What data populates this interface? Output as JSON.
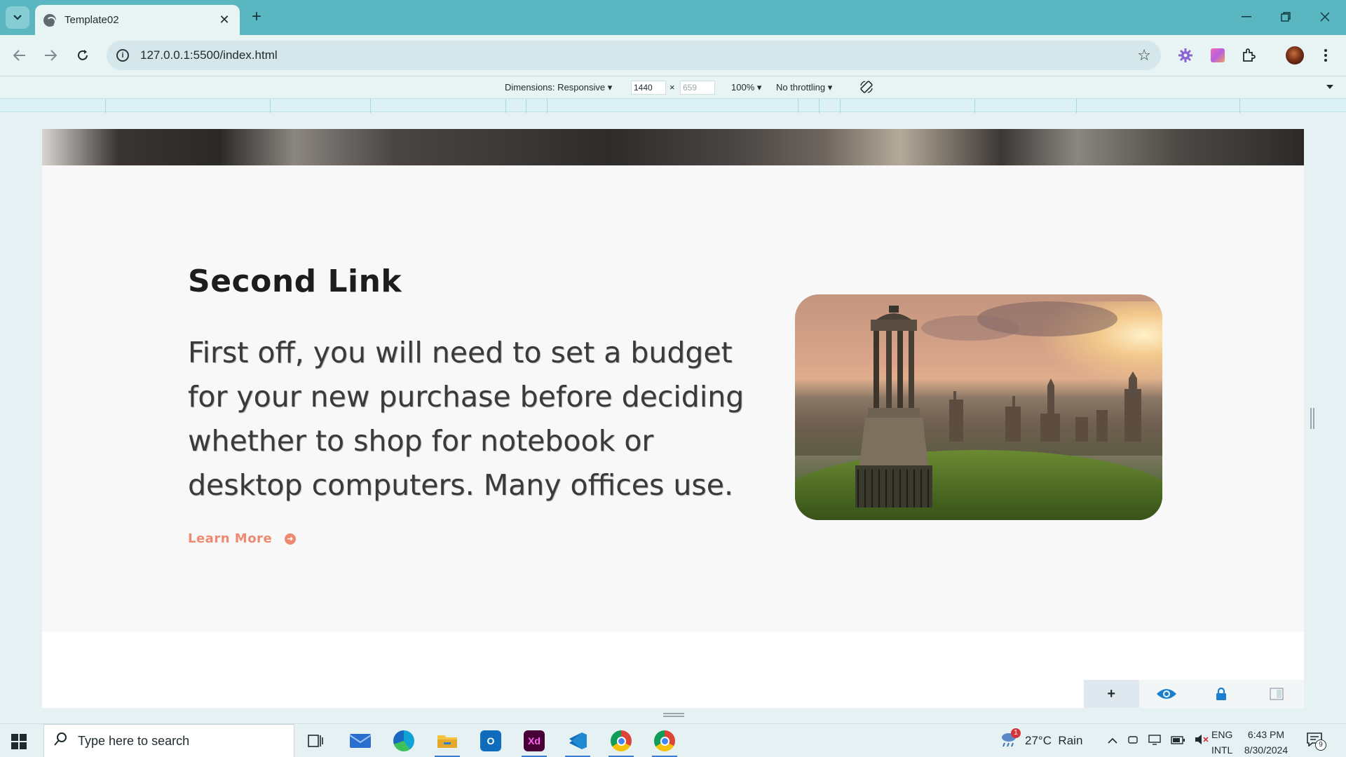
{
  "browser": {
    "tab_title": "Template02",
    "tab_close": "✕",
    "new_tab": "+",
    "url": "127.0.0.1:5500/index.html"
  },
  "devtools": {
    "dimensions_label": "Dimensions: Responsive",
    "width_value": "1440",
    "times": "×",
    "height_placeholder": "659",
    "zoom_label": "100%",
    "throttle_label": "No throttling"
  },
  "page": {
    "heading": "Second Link",
    "body": "First off, you will need to set a budget for your new purchase before deciding whether to shop for notebook or desktop computers. Many offices use.",
    "learn_more": "Learn More"
  },
  "taskbar": {
    "search_placeholder": "Type here to search",
    "weather": "27°C  Rain",
    "weather_badge": "1",
    "lang_top": "ENG",
    "lang_bottom": "INTL",
    "time": "6:43 PM",
    "date": "8/30/2024",
    "notif_count": "9"
  },
  "colors": {
    "tab_strip": "#5ab7c1",
    "accent_link": "#ef8a72",
    "page_bg": "#f8f8f8"
  },
  "icons": [
    "tab-search-icon",
    "back-icon",
    "forward-icon",
    "reload-icon",
    "info-icon",
    "star-icon",
    "extension-icon",
    "profile-avatar",
    "rotate-icon",
    "plus-icon",
    "eye-icon",
    "lock-icon",
    "windows-start-icon",
    "search-icon",
    "task-view-icon",
    "mail-icon",
    "edge-icon",
    "file-explorer-icon",
    "outlook-icon",
    "xd-icon",
    "vscode-icon",
    "chrome-icon"
  ]
}
